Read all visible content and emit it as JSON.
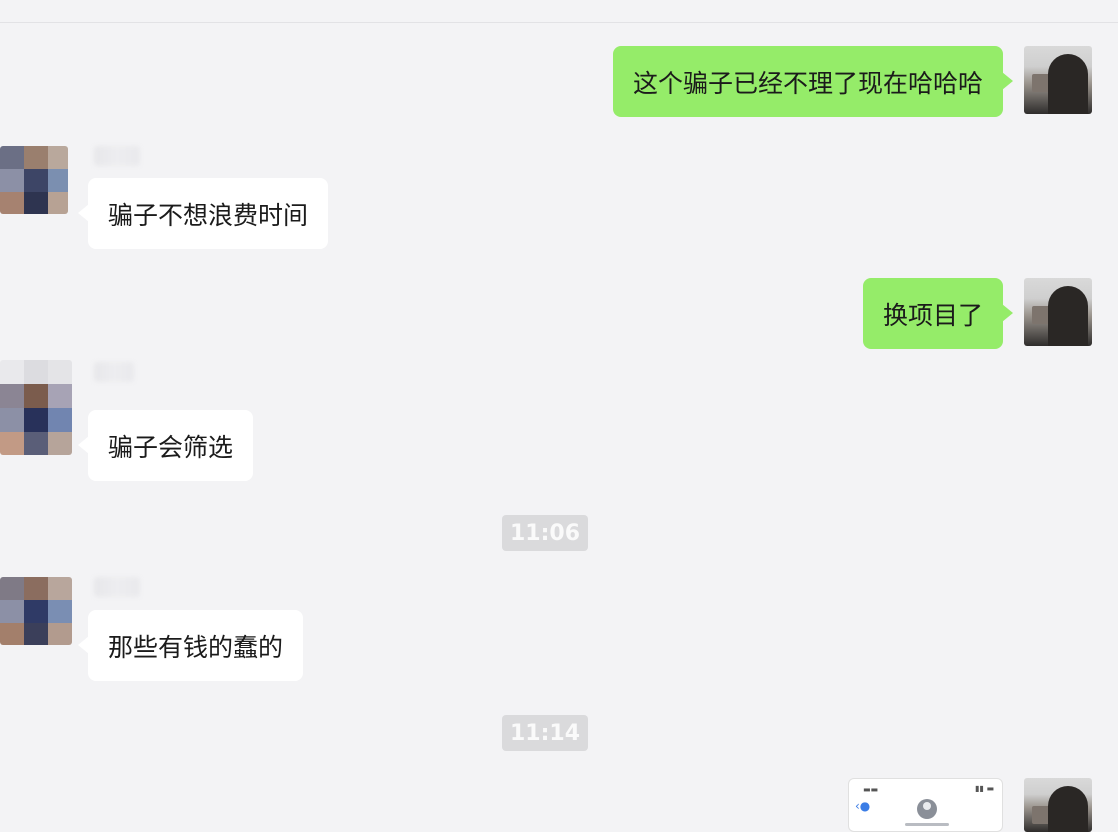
{
  "messages": [
    {
      "side": "right",
      "text": "这个骗子已经不理了现在哈哈哈"
    },
    {
      "side": "left",
      "text": "骗子不想浪费时间"
    },
    {
      "side": "right",
      "text": "换项目了"
    },
    {
      "side": "left",
      "text": "骗子会筛选"
    },
    {
      "side": "left",
      "text": "那些有钱的蠢的"
    },
    {
      "side": "right",
      "type": "image"
    }
  ],
  "timestamps": [
    "11:06",
    "11:14"
  ],
  "colors": {
    "background": "#f3f3f5",
    "sent_bubble": "#95ec69",
    "received_bubble": "#ffffff",
    "time_badge": "#dadadc"
  }
}
